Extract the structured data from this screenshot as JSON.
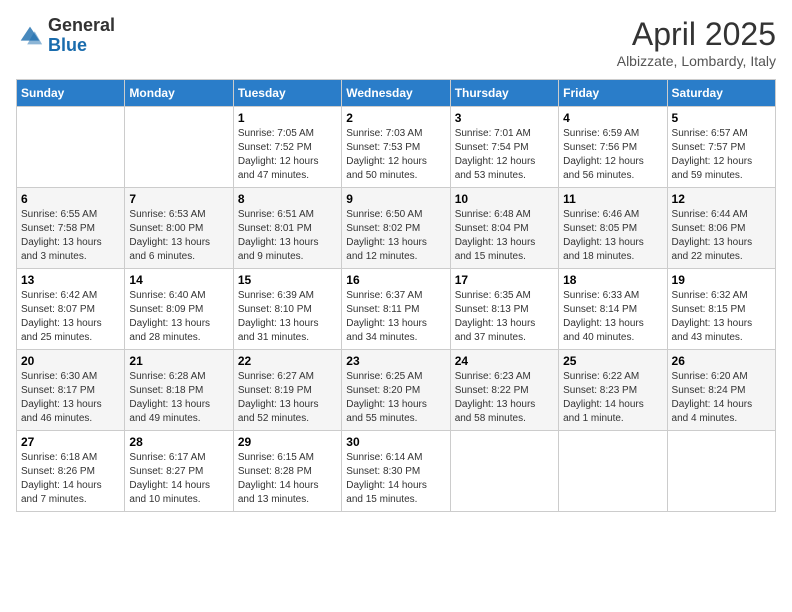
{
  "header": {
    "logo_general": "General",
    "logo_blue": "Blue",
    "month_year": "April 2025",
    "location": "Albizzate, Lombardy, Italy"
  },
  "days_of_week": [
    "Sunday",
    "Monday",
    "Tuesday",
    "Wednesday",
    "Thursday",
    "Friday",
    "Saturday"
  ],
  "weeks": [
    [
      {
        "day": "",
        "info": ""
      },
      {
        "day": "",
        "info": ""
      },
      {
        "day": "1",
        "info": "Sunrise: 7:05 AM\nSunset: 7:52 PM\nDaylight: 12 hours and 47 minutes."
      },
      {
        "day": "2",
        "info": "Sunrise: 7:03 AM\nSunset: 7:53 PM\nDaylight: 12 hours and 50 minutes."
      },
      {
        "day": "3",
        "info": "Sunrise: 7:01 AM\nSunset: 7:54 PM\nDaylight: 12 hours and 53 minutes."
      },
      {
        "day": "4",
        "info": "Sunrise: 6:59 AM\nSunset: 7:56 PM\nDaylight: 12 hours and 56 minutes."
      },
      {
        "day": "5",
        "info": "Sunrise: 6:57 AM\nSunset: 7:57 PM\nDaylight: 12 hours and 59 minutes."
      }
    ],
    [
      {
        "day": "6",
        "info": "Sunrise: 6:55 AM\nSunset: 7:58 PM\nDaylight: 13 hours and 3 minutes."
      },
      {
        "day": "7",
        "info": "Sunrise: 6:53 AM\nSunset: 8:00 PM\nDaylight: 13 hours and 6 minutes."
      },
      {
        "day": "8",
        "info": "Sunrise: 6:51 AM\nSunset: 8:01 PM\nDaylight: 13 hours and 9 minutes."
      },
      {
        "day": "9",
        "info": "Sunrise: 6:50 AM\nSunset: 8:02 PM\nDaylight: 13 hours and 12 minutes."
      },
      {
        "day": "10",
        "info": "Sunrise: 6:48 AM\nSunset: 8:04 PM\nDaylight: 13 hours and 15 minutes."
      },
      {
        "day": "11",
        "info": "Sunrise: 6:46 AM\nSunset: 8:05 PM\nDaylight: 13 hours and 18 minutes."
      },
      {
        "day": "12",
        "info": "Sunrise: 6:44 AM\nSunset: 8:06 PM\nDaylight: 13 hours and 22 minutes."
      }
    ],
    [
      {
        "day": "13",
        "info": "Sunrise: 6:42 AM\nSunset: 8:07 PM\nDaylight: 13 hours and 25 minutes."
      },
      {
        "day": "14",
        "info": "Sunrise: 6:40 AM\nSunset: 8:09 PM\nDaylight: 13 hours and 28 minutes."
      },
      {
        "day": "15",
        "info": "Sunrise: 6:39 AM\nSunset: 8:10 PM\nDaylight: 13 hours and 31 minutes."
      },
      {
        "day": "16",
        "info": "Sunrise: 6:37 AM\nSunset: 8:11 PM\nDaylight: 13 hours and 34 minutes."
      },
      {
        "day": "17",
        "info": "Sunrise: 6:35 AM\nSunset: 8:13 PM\nDaylight: 13 hours and 37 minutes."
      },
      {
        "day": "18",
        "info": "Sunrise: 6:33 AM\nSunset: 8:14 PM\nDaylight: 13 hours and 40 minutes."
      },
      {
        "day": "19",
        "info": "Sunrise: 6:32 AM\nSunset: 8:15 PM\nDaylight: 13 hours and 43 minutes."
      }
    ],
    [
      {
        "day": "20",
        "info": "Sunrise: 6:30 AM\nSunset: 8:17 PM\nDaylight: 13 hours and 46 minutes."
      },
      {
        "day": "21",
        "info": "Sunrise: 6:28 AM\nSunset: 8:18 PM\nDaylight: 13 hours and 49 minutes."
      },
      {
        "day": "22",
        "info": "Sunrise: 6:27 AM\nSunset: 8:19 PM\nDaylight: 13 hours and 52 minutes."
      },
      {
        "day": "23",
        "info": "Sunrise: 6:25 AM\nSunset: 8:20 PM\nDaylight: 13 hours and 55 minutes."
      },
      {
        "day": "24",
        "info": "Sunrise: 6:23 AM\nSunset: 8:22 PM\nDaylight: 13 hours and 58 minutes."
      },
      {
        "day": "25",
        "info": "Sunrise: 6:22 AM\nSunset: 8:23 PM\nDaylight: 14 hours and 1 minute."
      },
      {
        "day": "26",
        "info": "Sunrise: 6:20 AM\nSunset: 8:24 PM\nDaylight: 14 hours and 4 minutes."
      }
    ],
    [
      {
        "day": "27",
        "info": "Sunrise: 6:18 AM\nSunset: 8:26 PM\nDaylight: 14 hours and 7 minutes."
      },
      {
        "day": "28",
        "info": "Sunrise: 6:17 AM\nSunset: 8:27 PM\nDaylight: 14 hours and 10 minutes."
      },
      {
        "day": "29",
        "info": "Sunrise: 6:15 AM\nSunset: 8:28 PM\nDaylight: 14 hours and 13 minutes."
      },
      {
        "day": "30",
        "info": "Sunrise: 6:14 AM\nSunset: 8:30 PM\nDaylight: 14 hours and 15 minutes."
      },
      {
        "day": "",
        "info": ""
      },
      {
        "day": "",
        "info": ""
      },
      {
        "day": "",
        "info": ""
      }
    ]
  ]
}
